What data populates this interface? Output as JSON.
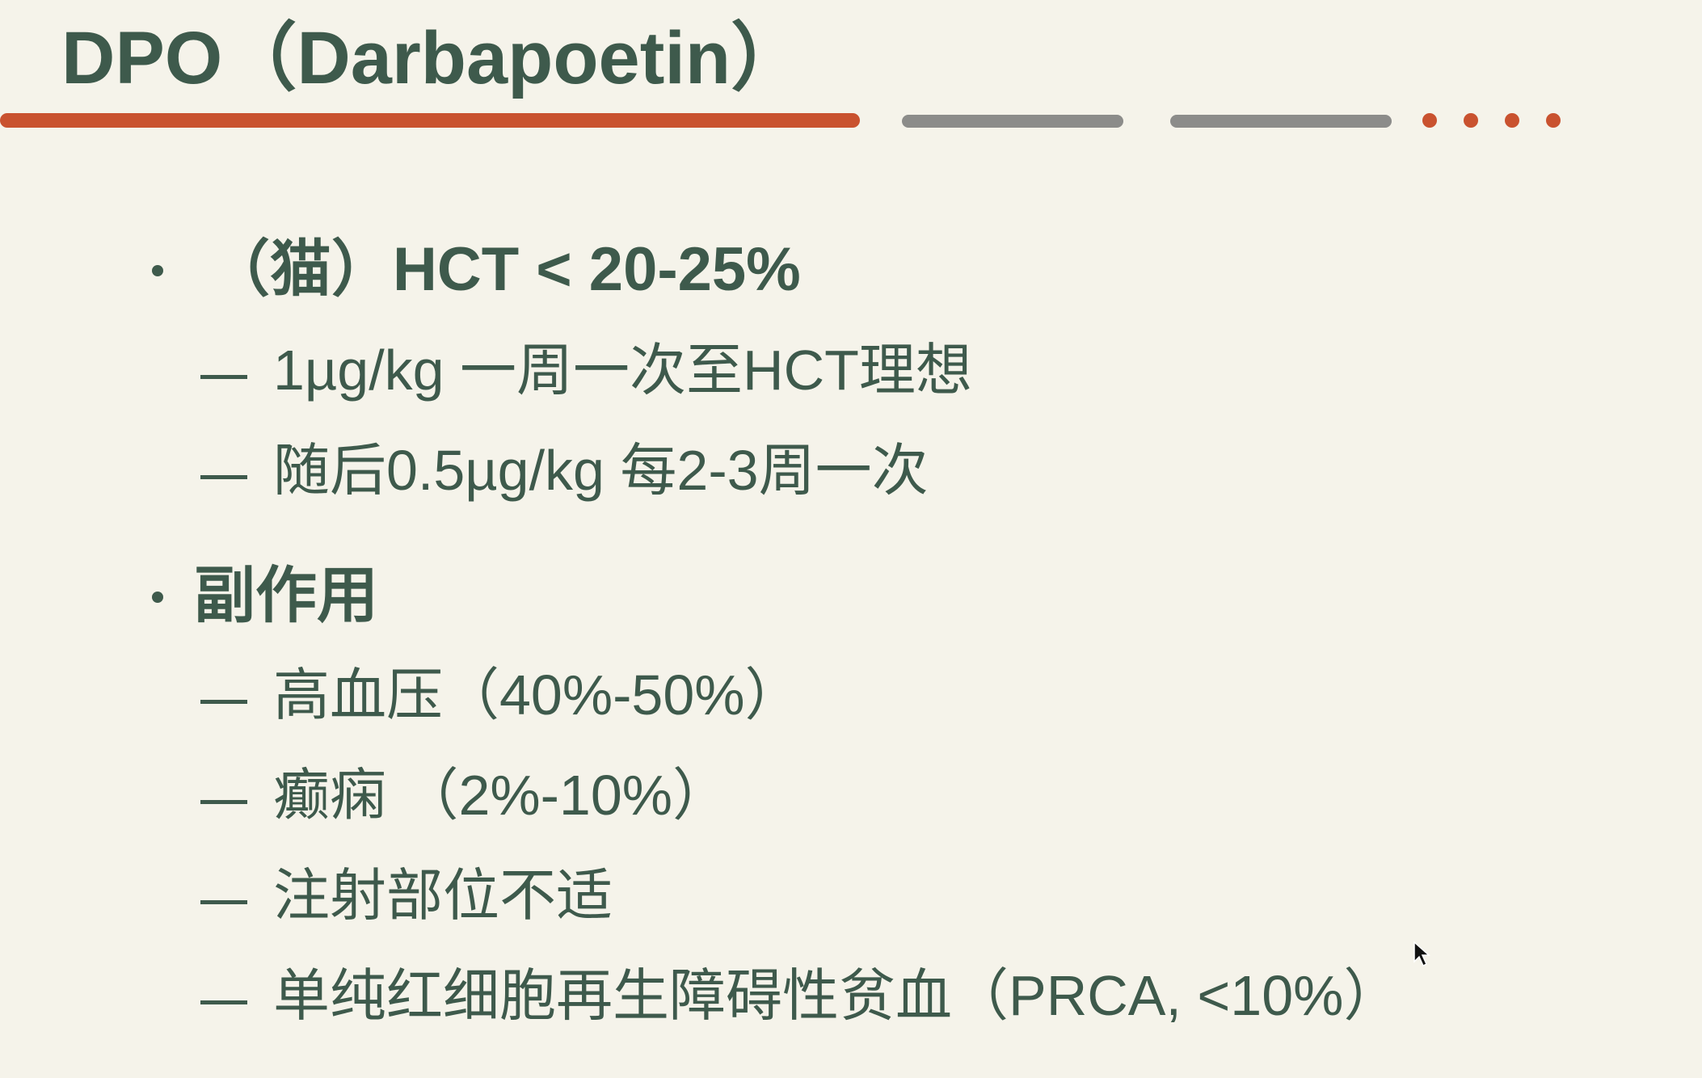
{
  "slide": {
    "title": "DPO（Darbapoetin）",
    "bullets": [
      {
        "label": "（猫）HCT < 20-25%",
        "subitems": [
          "1µg/kg 一周一次至HCT理想",
          "随后0.5µg/kg 每2-3周一次"
        ]
      },
      {
        "label": "副作用",
        "subitems": [
          "高血压（40%-50%）",
          "癫痫 （2%-10%）",
          "注射部位不适",
          "单纯红细胞再生障碍性贫血（PRCA, <10%）"
        ]
      }
    ]
  },
  "colors": {
    "background": "#f5f3ea",
    "text": "#3e5a4c",
    "accent": "#c9522f",
    "divider_gray": "#8c8c8a"
  },
  "icons": {
    "cursor": "mouse-pointer-icon"
  }
}
